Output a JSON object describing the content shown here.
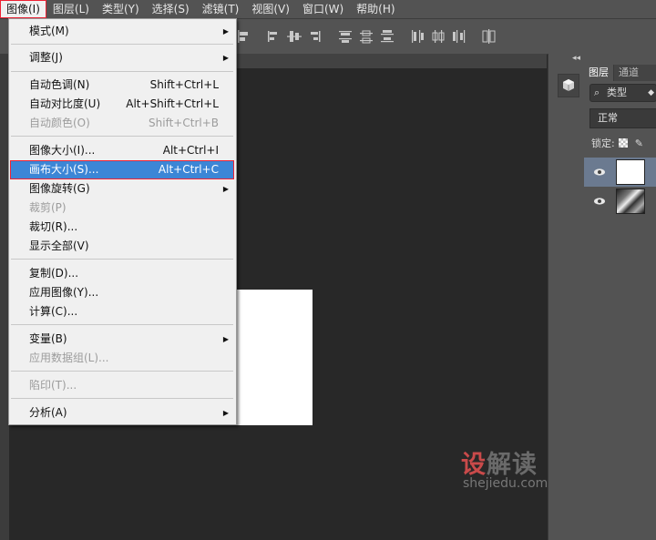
{
  "menubar": [
    {
      "label": "图像(I)",
      "active": true
    },
    {
      "label": "图层(L)"
    },
    {
      "label": "类型(Y)"
    },
    {
      "label": "选择(S)"
    },
    {
      "label": "滤镜(T)"
    },
    {
      "label": "视图(V)"
    },
    {
      "label": "窗口(W)"
    },
    {
      "label": "帮助(H)"
    }
  ],
  "image_menu": {
    "items": [
      {
        "label": "模式(M)",
        "submenu": true
      },
      {
        "label": "调整(J)",
        "submenu": true
      },
      {
        "label": "自动色调(N)",
        "shortcut": "Shift+Ctrl+L"
      },
      {
        "label": "自动对比度(U)",
        "shortcut": "Alt+Shift+Ctrl+L"
      },
      {
        "label": "自动颜色(O)",
        "shortcut": "Shift+Ctrl+B",
        "disabled": true
      },
      {
        "label": "图像大小(I)...",
        "shortcut": "Alt+Ctrl+I"
      },
      {
        "label": "画布大小(S)...",
        "shortcut": "Alt+Ctrl+C",
        "highlighted": true
      },
      {
        "label": "图像旋转(G)",
        "submenu": true
      },
      {
        "label": "裁剪(P)",
        "disabled": true
      },
      {
        "label": "裁切(R)..."
      },
      {
        "label": "显示全部(V)"
      },
      {
        "label": "复制(D)..."
      },
      {
        "label": "应用图像(Y)..."
      },
      {
        "label": "计算(C)..."
      },
      {
        "label": "变量(B)",
        "submenu": true
      },
      {
        "label": "应用数据组(L)...",
        "disabled": true
      },
      {
        "label": "陷印(T)...",
        "disabled": true
      },
      {
        "label": "分析(A)",
        "submenu": true
      }
    ],
    "submenu_arrow": "▶"
  },
  "layers_panel": {
    "tabs": [
      "图层",
      "通道"
    ],
    "collapse_glyph": "◂◂",
    "filter_icon": "⌕",
    "filter_label": "类型",
    "dropdown_arrow": "◆",
    "blend_mode": "正常",
    "lock_label": "锁定:",
    "brush_icon": "✎"
  },
  "watermark": {
    "logo_part1": "设",
    "logo_part2": "解读",
    "url": "shejiedu.com"
  },
  "colors": {
    "menu_highlight": "#3c86d6",
    "annotation_red": "#e22233",
    "ui_gray": "#535353",
    "canvas_bg": "#282828"
  }
}
